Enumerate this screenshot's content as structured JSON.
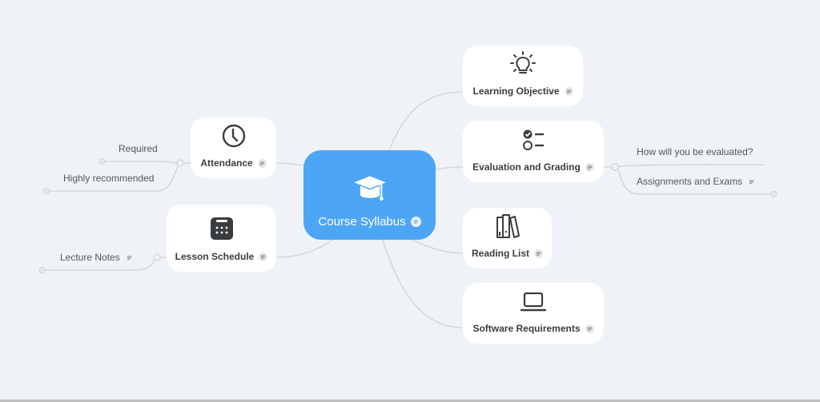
{
  "map": {
    "root": {
      "label": "Course Syllabus",
      "icon": "graduation-cap-icon",
      "color": "#4da6f5",
      "has_note": true
    },
    "right_branches": [
      {
        "label": "Learning Objective",
        "icon": "lightbulb-icon",
        "has_note": true,
        "children": []
      },
      {
        "label": "Evaluation and Grading",
        "icon": "checklist-icon",
        "has_note": true,
        "children": [
          {
            "label": "How will you be evaluated?",
            "has_note": false
          },
          {
            "label": "Assignments and Exams",
            "has_note": true
          }
        ]
      },
      {
        "label": "Reading List",
        "icon": "books-icon",
        "has_note": true,
        "children": []
      },
      {
        "label": "Software Requirements",
        "icon": "laptop-icon",
        "has_note": true,
        "children": []
      }
    ],
    "left_branches": [
      {
        "label": "Attendance",
        "icon": "clock-icon",
        "has_note": true,
        "children": [
          {
            "label": "Required",
            "has_note": false
          },
          {
            "label": "Highly recommended",
            "has_note": false
          }
        ]
      },
      {
        "label": "Lesson Schedule",
        "icon": "calendar-icon",
        "has_note": true,
        "children": [
          {
            "label": "Lecture Notes",
            "has_note": true
          }
        ]
      }
    ]
  }
}
